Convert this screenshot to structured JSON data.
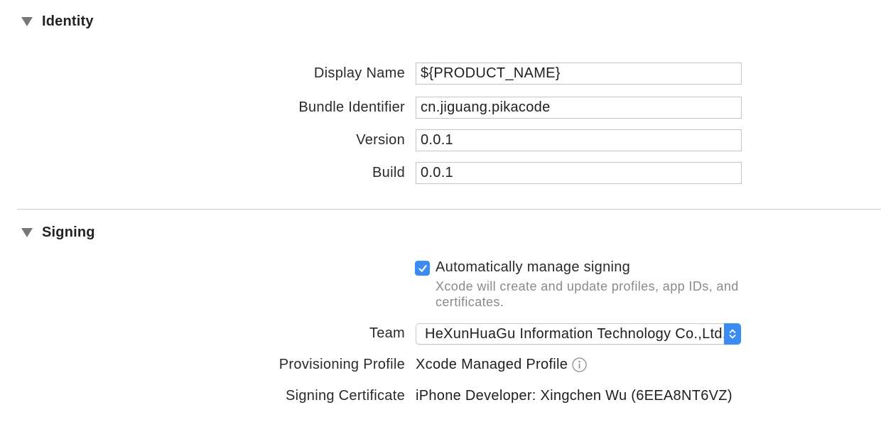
{
  "identity": {
    "title": "Identity",
    "fields": [
      {
        "label": "Display Name",
        "value": "${PRODUCT_NAME}"
      },
      {
        "label": "Bundle Identifier",
        "value": "cn.jiguang.pikacode"
      },
      {
        "label": "Version",
        "value": "0.0.1"
      },
      {
        "label": "Build",
        "value": "0.0.1"
      }
    ]
  },
  "signing": {
    "title": "Signing",
    "auto_manage": {
      "checked": true,
      "label": "Automatically manage signing",
      "help": "Xcode will create and update profiles, app IDs, and certificates."
    },
    "team": {
      "label": "Team",
      "value": "HeXunHuaGu Information Technology Co.,Ltd."
    },
    "provisioning_profile": {
      "label": "Provisioning Profile",
      "value": "Xcode Managed Profile",
      "icon": "info-icon"
    },
    "signing_certificate": {
      "label": "Signing Certificate",
      "value": "iPhone Developer: Xingchen Wu (6EEA8NT6VZ)"
    }
  },
  "colors": {
    "accent": "#3a8cf2",
    "help_text": "#8a8a8a",
    "divider": "#cfcfcf"
  }
}
